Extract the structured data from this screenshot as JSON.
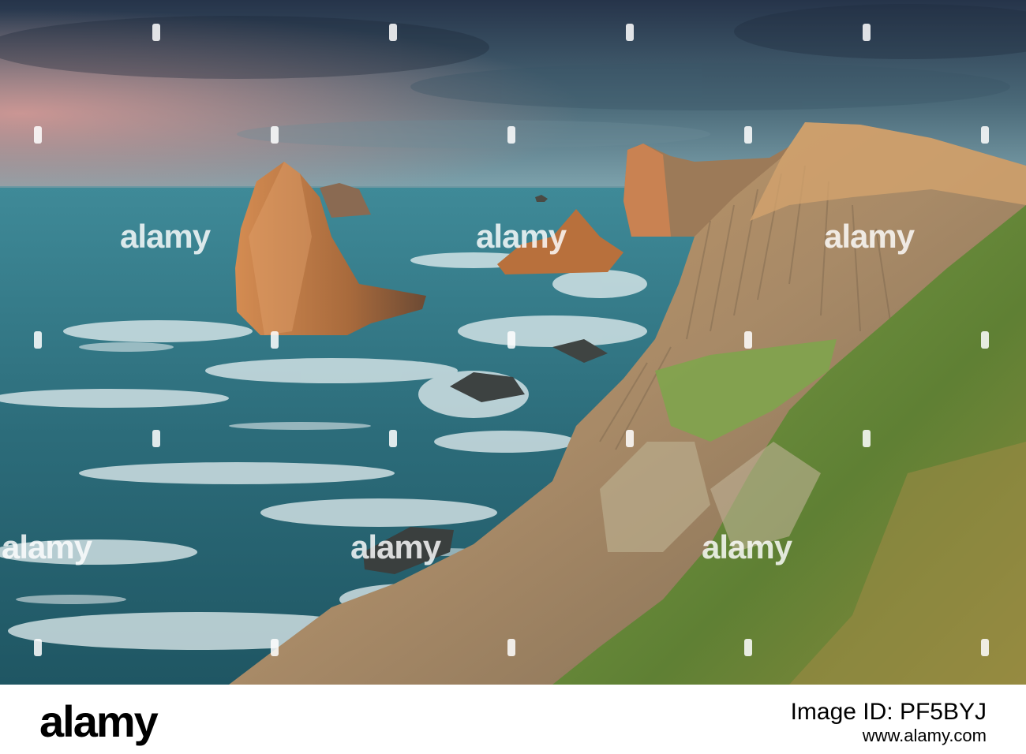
{
  "watermark": {
    "text": "alamy"
  },
  "footer": {
    "logo": "alamy",
    "image_id_label": "Image ID: PF5BYJ",
    "url": "www.alamy.com"
  },
  "colors": {
    "sky_top": "#2b3a4e",
    "sky_mid": "#4e6d7c",
    "sky_pink": "#c48a8c",
    "sea": "#2f6f7d",
    "foam": "#e4eef1",
    "rock_lit": "#c47a45",
    "cliff": "#a48a66",
    "grass": "#6f8f3a"
  }
}
